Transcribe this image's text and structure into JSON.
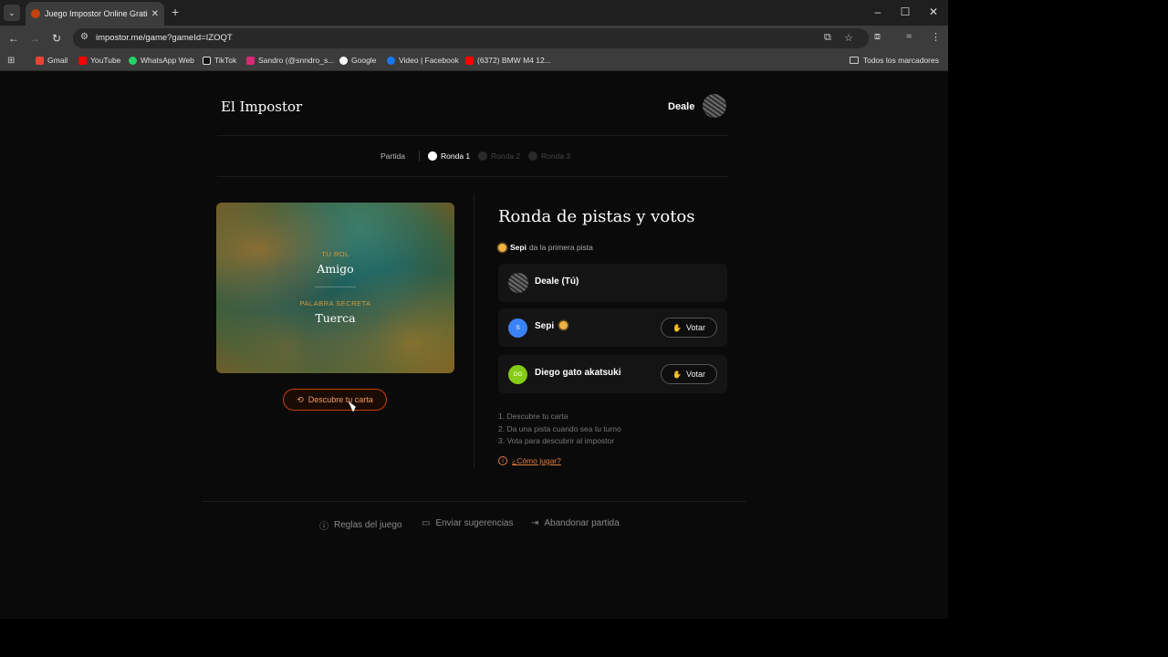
{
  "browser": {
    "tab_title": "Juego Impostor Online Gratis -",
    "url": "impostor.me/game?gameId=IZOQT",
    "bookmarks": [
      {
        "label": "Gmail",
        "color": "#ea4335"
      },
      {
        "label": "YouTube",
        "color": "#ff0000"
      },
      {
        "label": "WhatsApp Web",
        "color": "#25d366"
      },
      {
        "label": "TikTok",
        "color": "#ffffff"
      },
      {
        "label": "Sandro (@snndro_s...",
        "color": "#d62976"
      },
      {
        "label": "Google",
        "color": "#ffffff"
      },
      {
        "label": "Video | Facebook",
        "color": "#1877f2"
      },
      {
        "label": "(6372) BMW M4 12...",
        "color": "#ff0000"
      }
    ],
    "all_bookmarks": "Todos los marcadores"
  },
  "header": {
    "logo": "El Impostor",
    "user": "Deale"
  },
  "stepper": {
    "game": "Partida",
    "rounds": [
      "Ronda 1",
      "Ronda 2",
      "Ronda 3"
    ]
  },
  "card": {
    "role_label": "TU ROL",
    "role": "Amigo",
    "word_label": "PALABRA SECRETA",
    "word": "Tuerca",
    "reveal_button": "Descubre tu carta"
  },
  "round": {
    "title": "Ronda de pistas y votos",
    "first_player": "Sepi",
    "first_clue_text": "da la primera pista",
    "players": [
      {
        "name": "Deale (Tú)",
        "initials": "",
        "color": "",
        "vote": ""
      },
      {
        "name": "Sepi",
        "initials": "S",
        "color": "#3b82f6",
        "vote": "Votar"
      },
      {
        "name": "Diego gato akatsuki",
        "initials": "DG",
        "color": "#84cc16",
        "vote": "Votar"
      }
    ],
    "steps": [
      "1. Descubre tu carta",
      "2. Da una pista cuando sea tu turno",
      "3. Vota para descubrir al impostor"
    ],
    "how_to": "¿Cómo jugar?"
  },
  "footer": {
    "rules": "Reglas del juego",
    "feedback": "Enviar sugerencias",
    "leave": "Abandonar partida"
  },
  "colors": {
    "accent": "#e07a3a",
    "background": "#0a0a0a"
  }
}
